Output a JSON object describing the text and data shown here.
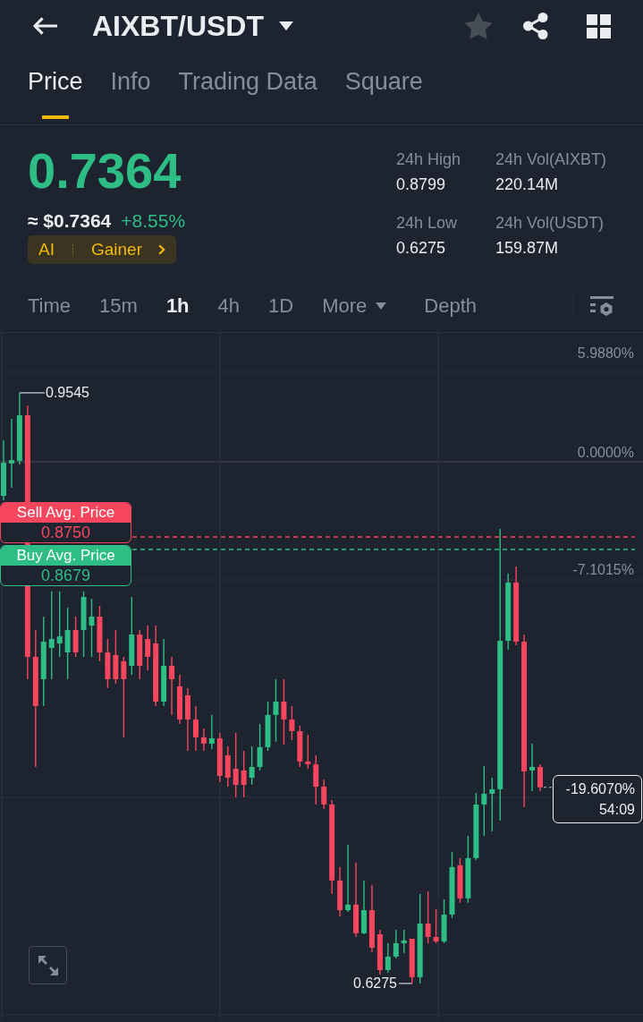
{
  "header": {
    "title": "AIXBT/USDT",
    "favorited": false
  },
  "tabs": [
    {
      "label": "Price",
      "selected": true
    },
    {
      "label": "Info",
      "selected": false
    },
    {
      "label": "Trading Data",
      "selected": false
    },
    {
      "label": "Square",
      "selected": false
    }
  ],
  "ticker": {
    "price": "0.7364",
    "fiat_price": "≈ $0.7364",
    "change": "+8.55%",
    "tags": [
      "AI",
      "Gainer"
    ]
  },
  "stats": [
    {
      "label": "24h High",
      "value": "0.8799"
    },
    {
      "label": "24h Vol(AIXBT)",
      "value": "220.14M"
    },
    {
      "label": "24h Low",
      "value": "0.6275"
    },
    {
      "label": "24h Vol(USDT)",
      "value": "159.87M"
    }
  ],
  "intervals": [
    {
      "label": "Time",
      "kind": "option",
      "selected": false
    },
    {
      "label": "15m",
      "kind": "option",
      "selected": false
    },
    {
      "label": "1h",
      "kind": "option",
      "selected": true
    },
    {
      "label": "4h",
      "kind": "option",
      "selected": false
    },
    {
      "label": "1D",
      "kind": "option",
      "selected": false
    },
    {
      "label": "More",
      "kind": "dropdown",
      "selected": false
    },
    {
      "label": "Depth",
      "kind": "option",
      "selected": false
    }
  ],
  "chart": {
    "chart_data": {
      "type": "candlestick",
      "categories": [
        null,
        null,
        null,
        null,
        null,
        null,
        null,
        null,
        null,
        null,
        null,
        null,
        null,
        null,
        null,
        null,
        null,
        null,
        null,
        null,
        null,
        null,
        null,
        null,
        null,
        null,
        null,
        null,
        null,
        null,
        null,
        null,
        null,
        null,
        null,
        null,
        null,
        null,
        null,
        null,
        null,
        null,
        null,
        null,
        null,
        null,
        null,
        null,
        null,
        null,
        null,
        null,
        null,
        null,
        null,
        null,
        null,
        null,
        null,
        null,
        null,
        null,
        null,
        null,
        null,
        null,
        null,
        null
      ],
      "ohlc": [
        [
          -2.0,
          1.35,
          -2.27,
          0
        ],
        [
          -0.05,
          2.65,
          -1.51,
          0.16
        ],
        [
          0.11,
          4.22,
          -0.11,
          2.86
        ],
        [
          2.86,
          3.46,
          -13.08,
          -11.73
        ],
        [
          -11.73,
          -10.11,
          -18.38,
          -14.7
        ],
        [
          -13.08,
          -9.3,
          -14.7,
          -10.81
        ],
        [
          -11.19,
          -7.78,
          -13.08,
          -10.65
        ],
        [
          -10.92,
          -7.78,
          -11.73,
          -10.49
        ],
        [
          -11.46,
          -8.76,
          -13.08,
          -10.11
        ],
        [
          -10.11,
          -9.3,
          -11.73,
          -11.46
        ],
        [
          -10.11,
          -7.78,
          -11.73,
          -8.11
        ],
        [
          -9.84,
          -8.22,
          -11.73,
          -9.3
        ],
        [
          -9.3,
          -8.65,
          -12.0,
          -11.46
        ],
        [
          -11.46,
          -10.65,
          -13.62,
          -13.08
        ],
        [
          -11.62,
          -10.11,
          -13.35,
          -13.08
        ],
        [
          -12.0,
          -11.73,
          -16.59,
          -13.08
        ],
        [
          -12.27,
          -8.11,
          -12.81,
          -10.38
        ],
        [
          -10.38,
          -10.11,
          -13.08,
          -12.27
        ],
        [
          -10.65,
          -9.84,
          -12.54,
          -11.73
        ],
        [
          -10.92,
          -9.84,
          -14.7,
          -14.43
        ],
        [
          -14.43,
          -10.65,
          -14.7,
          -12.27
        ],
        [
          -12.27,
          -11.73,
          -15.24,
          -13.08
        ],
        [
          -13.51,
          -12.81,
          -15.78,
          -15.51
        ],
        [
          -14.05,
          -13.62,
          -17.41,
          -15.51
        ],
        [
          -15.51,
          -14.7,
          -17.41,
          -16.59
        ],
        [
          -16.59,
          -16.05,
          -17.41,
          -16.97
        ],
        [
          -16.97,
          -15.24,
          -17.3,
          -16.65
        ],
        [
          -16.65,
          -16.32,
          -19.3,
          -18.92
        ],
        [
          -17.68,
          -17.14,
          -19.57,
          -19.03
        ],
        [
          -18.49,
          -16.32,
          -20.22,
          -19.46
        ],
        [
          -18.59,
          -17.41,
          -20.22,
          -19.46
        ],
        [
          -19.03,
          -17.14,
          -19.46,
          -18.38
        ],
        [
          -18.38,
          -15.78,
          -18.59,
          -17.19
        ],
        [
          -17.19,
          -14.43,
          -17.41,
          -15.24
        ],
        [
          -15.24,
          -13.08,
          -16.86,
          -14.43
        ],
        [
          -14.43,
          -13.08,
          -17.03,
          -15.51
        ],
        [
          -15.51,
          -14.7,
          -16.76,
          -16.22
        ],
        [
          -16.22,
          -15.89,
          -18.38,
          -18.05
        ],
        [
          -18.05,
          -16.43,
          -18.49,
          -18.22
        ],
        [
          -18.22,
          -17.68,
          -20.65,
          -19.57
        ],
        [
          -19.57,
          -19.14,
          -20.92,
          -20.65
        ],
        [
          -20.65,
          -20.38,
          -26.05,
          -25.24
        ],
        [
          -25.24,
          -24.43,
          -27.41,
          -27.03
        ],
        [
          -27.03,
          -23.08,
          -27.14,
          -26.7
        ],
        [
          -26.7,
          -24.16,
          -28.65,
          -28.43
        ],
        [
          -28.43,
          -25.24,
          -28.49,
          -27.03
        ],
        [
          -27.03,
          -25.51,
          -29.57,
          -29.3
        ],
        [
          -28.49,
          -28.22,
          -30.92,
          -30.65
        ],
        [
          -30.65,
          -29.03,
          -30.81,
          -29.84
        ],
        [
          -29.84,
          -28.22,
          -29.95,
          -29.03
        ],
        [
          -29.03,
          -28.22,
          -29.62,
          -28.86
        ],
        [
          -28.76,
          -28.76,
          -31.46,
          -31.08
        ],
        [
          -31.08,
          -26.05,
          -31.46,
          -27.84
        ],
        [
          -27.84,
          -25.89,
          -29.03,
          -28.65
        ],
        [
          -28.65,
          -26.97,
          -29.03,
          -28.92
        ],
        [
          -28.92,
          -26.38,
          -29.03,
          -27.3
        ],
        [
          -27.3,
          -23.51,
          -27.51,
          -24.43
        ],
        [
          -24.32,
          -23.89,
          -26.59,
          -26.32
        ],
        [
          -26.32,
          -22.54,
          -26.59,
          -23.89
        ],
        [
          -23.89,
          -19.95,
          -24.0,
          -20.65
        ],
        [
          -20.65,
          -18.32,
          -22.54,
          -20.0
        ],
        [
          -20.0,
          -19.03,
          -22.27,
          -19.73
        ],
        [
          -19.73,
          -4.0,
          -21.62,
          -10.76
        ],
        [
          -10.76,
          -6.7,
          -11.3,
          -7.24
        ],
        [
          -7.24,
          -6.27,
          -11.03,
          -10.81
        ],
        [
          -10.81,
          -10.38,
          -20.81,
          -18.65
        ],
        [
          -18.59,
          -16.97,
          -19.84,
          -18.38
        ],
        [
          -18.38,
          -18.22,
          -19.84,
          -19.61
        ]
      ],
      "ylim": [
        -33.68,
        7.84
      ],
      "yticks": [
        {
          "value": 5.988,
          "label": "5.9880%"
        },
        {
          "value": 0,
          "label": "0.0000%"
        },
        {
          "value": -7.1015,
          "label": "-7.1015%"
        }
      ]
    },
    "high_marker": "0.9545",
    "low_marker": "0.6275",
    "avg_prices": [
      {
        "kind": "sell",
        "label": "Sell Avg. Price",
        "value": "0.8750"
      },
      {
        "kind": "buy",
        "label": "Buy Avg. Price",
        "value": "0.8679"
      }
    ],
    "last_price": {
      "change": "-19.6070%",
      "countdown": "54:09"
    }
  }
}
